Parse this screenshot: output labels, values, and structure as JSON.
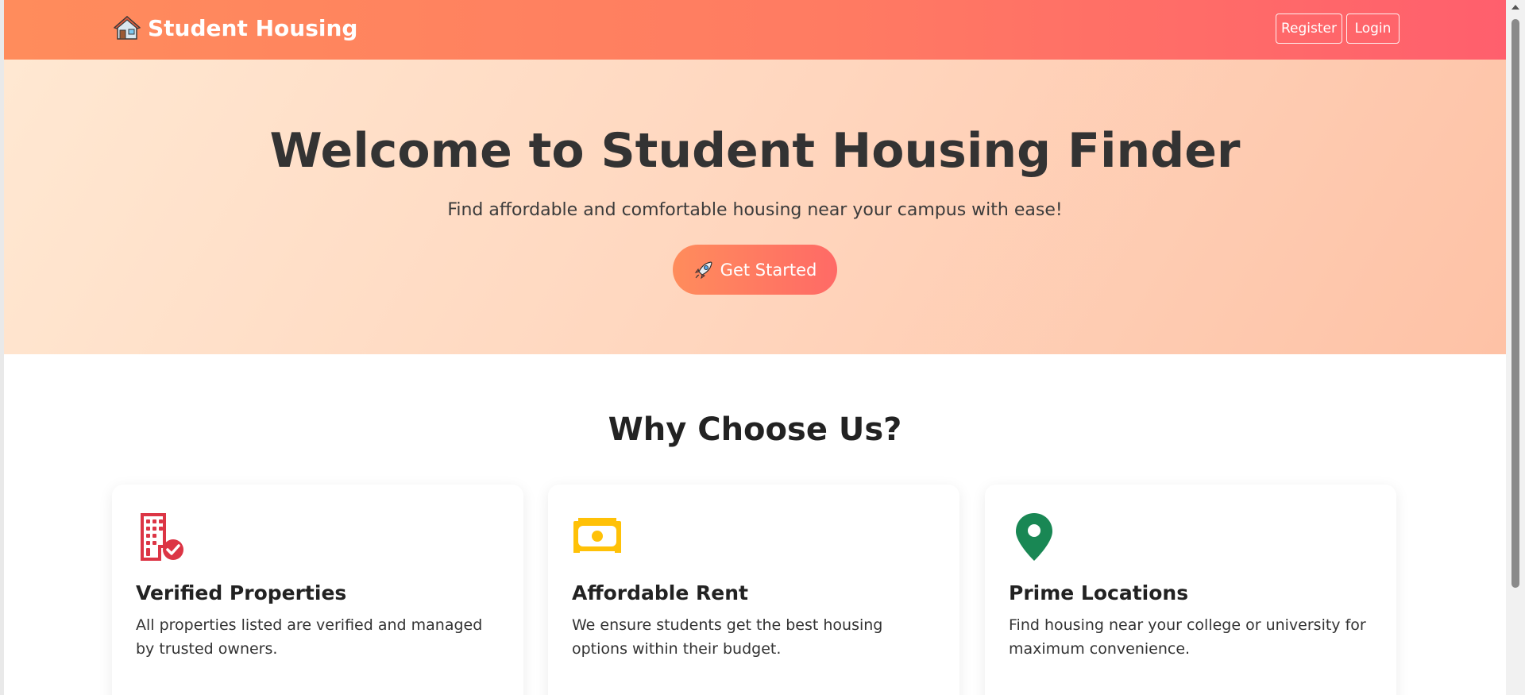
{
  "navbar": {
    "brand_label": "Student Housing",
    "brand_icon": "house-icon",
    "register_label": "Register",
    "login_label": "Login"
  },
  "hero": {
    "title": "Welcome to Student Housing Finder",
    "subtitle": "Find affordable and comfortable housing near your campus with ease!",
    "cta_label": "Get Started",
    "cta_icon": "rocket-icon"
  },
  "features": {
    "title": "Why Choose Us?",
    "items": [
      {
        "icon": "building-check-icon",
        "icon_color": "#dc3545",
        "title": "Verified Properties",
        "text": "All properties listed are verified and managed by trusted owners."
      },
      {
        "icon": "cash-icon",
        "icon_color": "#ffc107",
        "title": "Affordable Rent",
        "text": "We ensure students get the best housing options within their budget."
      },
      {
        "icon": "location-pin-icon",
        "icon_color": "#198754",
        "title": "Prime Locations",
        "text": "Find housing near your college or university for maximum convenience."
      }
    ]
  },
  "colors": {
    "navbar_start": "#ff8c5c",
    "navbar_end": "#ff5f6d",
    "hero_start": "#ffe8d2",
    "hero_end": "#fec2a6",
    "heading": "#333333"
  }
}
